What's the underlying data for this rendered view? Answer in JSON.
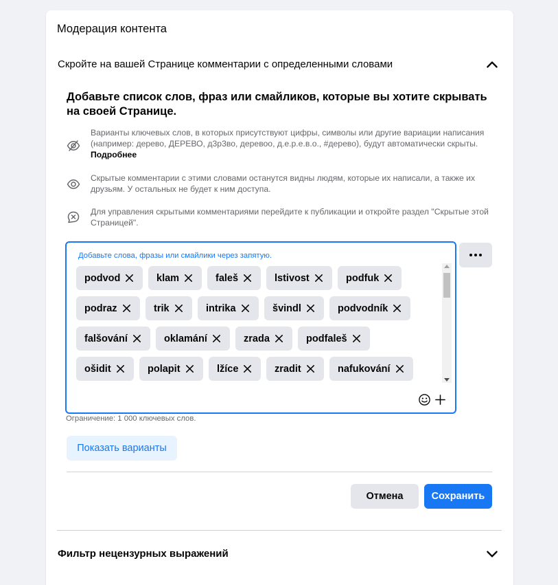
{
  "panel": {
    "title": "Модерация контента"
  },
  "section": {
    "title": "Скройте на вашей Странице комментарии с определенными словами",
    "heading": "Добавьте список слов, фраз или смайликов, которые вы хотите скрывать на своей Странице.",
    "info": [
      {
        "icon": "eye-slash-icon",
        "text": "Варианты ключевых слов, в которых присутствуют цифры, символы или другие вариации написания (например: дерево, ДЕРЕВО, д3р3во, деревоо, д.е.р.е.в.о., #дерево), будут автоматически скрыты. ",
        "link": "Подробнее"
      },
      {
        "icon": "eye-icon",
        "text": "Скрытые комментарии с этими словами останутся видны людям, которые их написали, а также их друзьям. У остальных не будет к ним доступа."
      },
      {
        "icon": "comment-hidden-icon",
        "text": "Для управления скрытыми комментариями перейдите к публикации и откройте раздел \"Скрытые этой Страницей\"."
      }
    ],
    "keywords_hint": "Добавьте слова, фразы или смайлики через запятую.",
    "keywords": [
      [
        "podvod",
        "klam",
        "faleš",
        "lstivost",
        "podfuk"
      ],
      [
        "podraz",
        "trik",
        "intrika",
        "švindl",
        "podvodník"
      ],
      [
        "falšování",
        "oklamání",
        "zrada",
        "podfaleš"
      ],
      [
        "ošidit",
        "polapit",
        "lžíce",
        "zradit",
        "nafukování"
      ]
    ],
    "limit_text": "Ограничение: 1 000 ключевых слов.",
    "show_variants_label": "Показать варианты",
    "cancel_label": "Отмена",
    "save_label": "Сохранить"
  },
  "filter_section": {
    "title": "Фильтр нецензурных выражений"
  },
  "colors": {
    "accent": "#1877f2",
    "chip_bg": "#e4e6eb",
    "secondary_text": "#65676b"
  }
}
